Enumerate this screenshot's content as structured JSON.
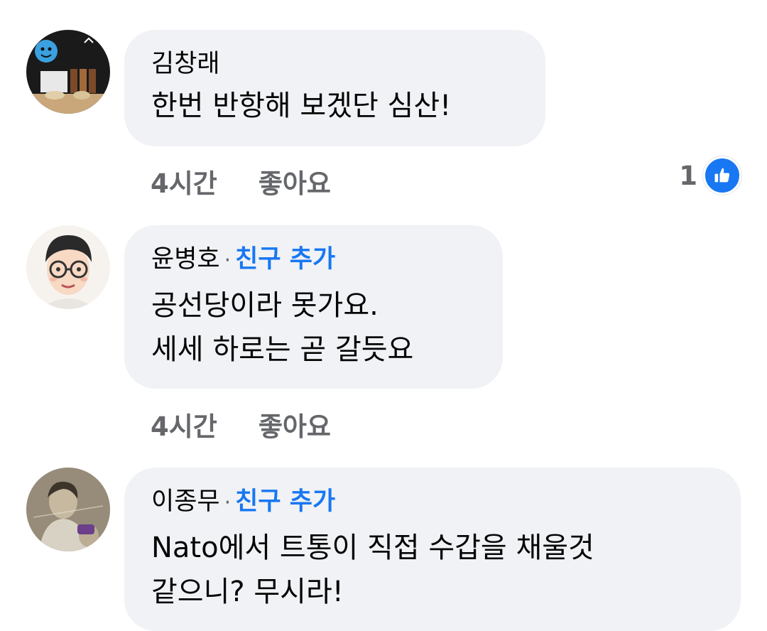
{
  "comments": [
    {
      "author": "김창래",
      "add_friend": "",
      "lines": [
        "한번 반항해 보겠단 심산!"
      ],
      "time": "4시간",
      "like_label": "좋아요",
      "reaction_count": "1"
    },
    {
      "author": "윤병호",
      "separator": "·",
      "add_friend": "친구 추가",
      "lines": [
        "공선당이라 못가요.",
        "세세 하로는 곧 갈듯요"
      ],
      "time": "4시간",
      "like_label": "좋아요"
    },
    {
      "author": "이종무",
      "separator": "·",
      "add_friend": "친구 추가",
      "lines": [
        "Nato에서 트통이 직접 수갑을 채울것",
        "같으니? 무시라!"
      ]
    }
  ],
  "colors": {
    "bubble": "#f0f2f5",
    "link": "#1877f2",
    "meta": "#65676b",
    "text": "#050505"
  },
  "icons": {
    "reaction": "like-thumbs-up-icon"
  }
}
